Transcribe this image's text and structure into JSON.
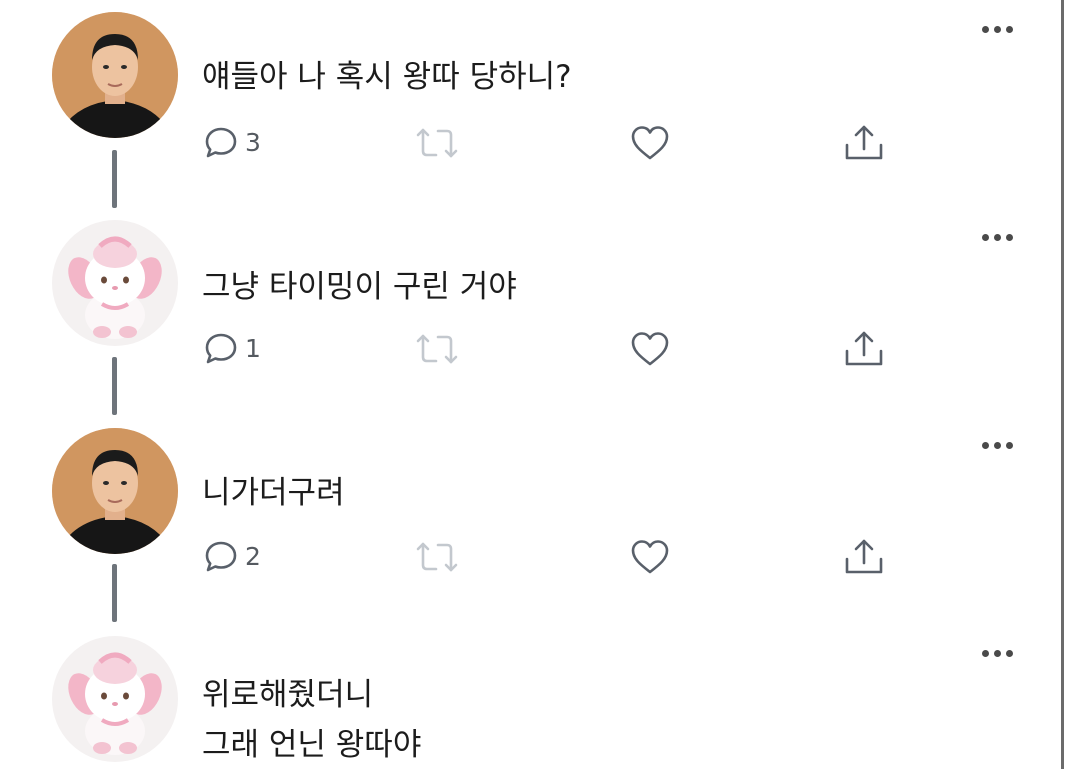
{
  "colors": {
    "icon": "#59606a",
    "retweet_icon": "#c3c8ce",
    "thread_line": "#6e747b",
    "text": "#1c1c1c"
  },
  "tweets": [
    {
      "avatar": "person-avatar",
      "lines": [
        "얘들아 나 혹시 왕따 당하니?"
      ],
      "reply_count": "3"
    },
    {
      "avatar": "plush-bunny-avatar",
      "lines": [
        "그냥 타이밍이 구린 거야"
      ],
      "reply_count": "1"
    },
    {
      "avatar": "person-avatar",
      "lines": [
        "니가더구려"
      ],
      "reply_count": "2"
    },
    {
      "avatar": "plush-bunny-avatar",
      "lines": [
        "위로해줬더니",
        "그래 언닌 왕따야"
      ]
    }
  ]
}
